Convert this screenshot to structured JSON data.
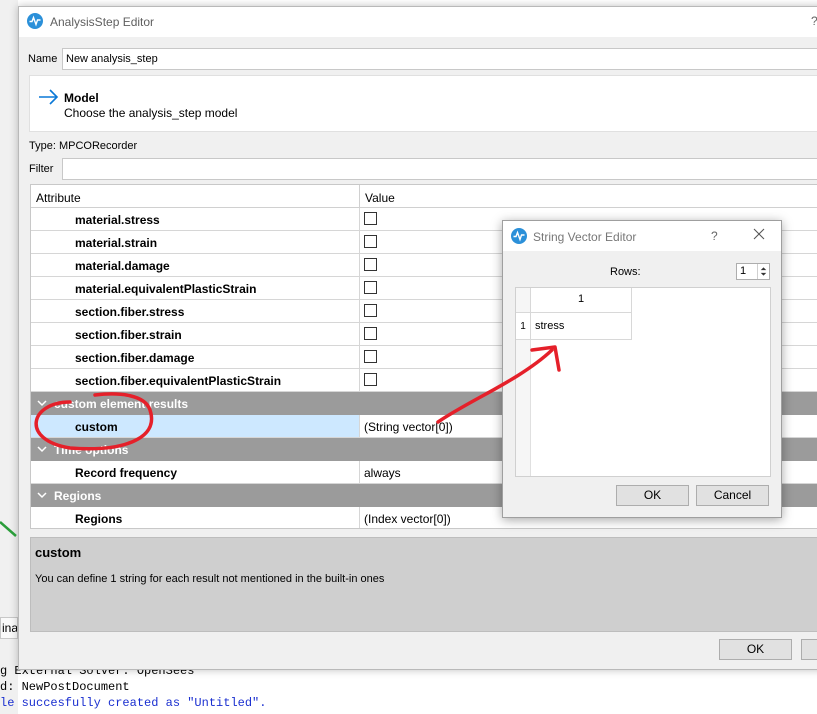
{
  "main_window": {
    "title": "AnalysisStep Editor",
    "help": "?",
    "name_label": "Name",
    "name_value": "New analysis_step",
    "model_title": "Model",
    "model_subtitle": "Choose the analysis_step model",
    "type_label": "Type: MPCORecorder",
    "filter_label": "Filter",
    "filter_value": "",
    "table": {
      "header_attribute": "Attribute",
      "header_value": "Value",
      "rows": [
        {
          "label": "material.stress",
          "checked": false
        },
        {
          "label": "material.strain",
          "checked": false
        },
        {
          "label": "material.damage",
          "checked": false
        },
        {
          "label": "material.equivalentPlasticStrain",
          "checked": false
        },
        {
          "label": "section.fiber.stress",
          "checked": false
        },
        {
          "label": "section.fiber.strain",
          "checked": false
        },
        {
          "label": "section.fiber.damage",
          "checked": false
        },
        {
          "label": "section.fiber.equivalentPlasticStrain",
          "checked": false
        }
      ],
      "group_custom": "custom element results",
      "custom_label": "custom",
      "custom_value": "(String vector[0])",
      "group_time": "Time options",
      "record_frequency_label": "Record frequency",
      "record_frequency_value": "always",
      "group_regions": "Regions",
      "regions_label": "Regions",
      "regions_value": "(Index vector[0])"
    },
    "description": {
      "title": "custom",
      "text": "You can define 1 string for each result not mentioned in the built-in ones"
    },
    "ok_label": "OK",
    "cancel_label": ""
  },
  "dialog": {
    "title": "String Vector Editor",
    "help": "?",
    "rows_label": "Rows:",
    "rows_value": "1",
    "column_header": "1",
    "row_header": "1",
    "cell_value": "stress",
    "ok_label": "OK",
    "cancel_label": "Cancel"
  },
  "background": {
    "tab_label": "inal",
    "console_lines": [
      "g External Solver: OpenSees",
      "d: NewPostDocument",
      "le succesfully created as \"Untitled\"."
    ]
  },
  "colors": {
    "accent": "#0a78d7",
    "group_bg": "#9b9b9b",
    "selection": "#cde8ff",
    "annotation": "#e5202a",
    "console_link": "#1a2fd0"
  },
  "icons": {
    "app": "waveform-icon",
    "model_arrow": "arrow-right-icon",
    "close": "close-icon",
    "chevron": "chevron-down-icon"
  }
}
